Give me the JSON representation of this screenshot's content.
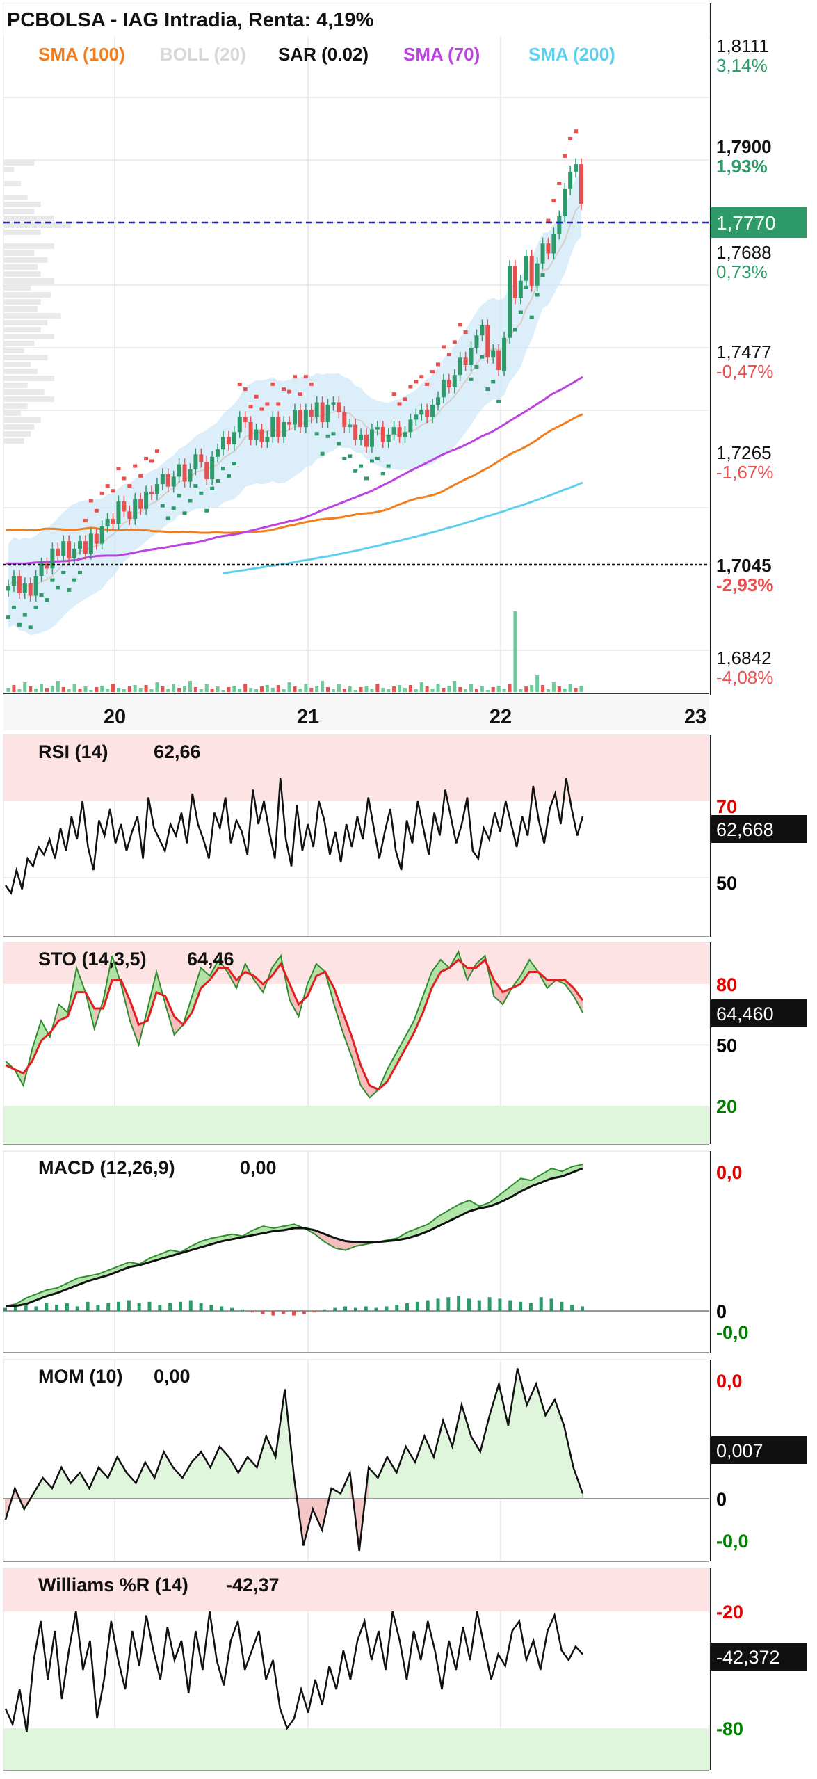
{
  "chart_data": {
    "type": "candlestick",
    "title": "PCBOLSA - IAG Intradia, Renta: 4,19%",
    "indicators_legend": [
      {
        "label": "SMA (100)",
        "color": "#f07d1e"
      },
      {
        "label": "BOLL (20)",
        "color": "#d8d8d8"
      },
      {
        "label": "SAR (0.02)",
        "color": "#111111"
      },
      {
        "label": "SMA (70)",
        "color": "#bb44e0"
      },
      {
        "label": "SMA (200)",
        "color": "#5dd0ee"
      }
    ],
    "x_ticks": [
      "20",
      "21",
      "22",
      "23"
    ],
    "price_levels": [
      {
        "value": "1,8111",
        "pct": "3,14%",
        "bold": false
      },
      {
        "value": "1,7900",
        "pct": "1,93%",
        "bold": true
      },
      {
        "value": "1,7688",
        "pct": "0,73%",
        "bold": false
      },
      {
        "value": "1,7477",
        "pct": "-0,47%",
        "bold": false
      },
      {
        "value": "1,7265",
        "pct": "-1,67%",
        "bold": false
      },
      {
        "value": "1,7045",
        "pct": "-2,93%",
        "bold": true
      },
      {
        "value": "1,6842",
        "pct": "-4,08%",
        "bold": false
      }
    ],
    "current_price": "1,7770",
    "reference_price": 1.7045,
    "y_range": [
      1.6842,
      1.8111
    ],
    "price_series": {
      "close": [
        1.7,
        1.702,
        1.6985,
        1.7005,
        1.698,
        1.702,
        1.7045,
        1.7035,
        1.7075,
        1.706,
        1.709,
        1.7055,
        1.7075,
        1.709,
        1.7065,
        1.7105,
        1.7085,
        1.712,
        1.7135,
        1.7125,
        1.717,
        1.715,
        1.7135,
        1.7175,
        1.7155,
        1.719,
        1.7185,
        1.7205,
        1.7225,
        1.72,
        1.722,
        1.7245,
        1.721,
        1.7235,
        1.7265,
        1.725,
        1.7215,
        1.726,
        1.7275,
        1.73,
        1.7285,
        1.731,
        1.734,
        1.733,
        1.7295,
        1.7315,
        1.729,
        1.73,
        1.734,
        1.73,
        1.733,
        1.7325,
        1.7355,
        1.732,
        1.7355,
        1.734,
        1.737,
        1.733,
        1.7365,
        1.737,
        1.735,
        1.732,
        1.7325,
        1.7295,
        1.7305,
        1.728,
        1.7315,
        1.732,
        1.729,
        1.7305,
        1.732,
        1.73,
        1.731,
        1.7335,
        1.7345,
        1.7355,
        1.734,
        1.7365,
        1.738,
        1.7415,
        1.74,
        1.7425,
        1.746,
        1.7445,
        1.748,
        1.7505,
        1.7525,
        1.746,
        1.7475,
        1.7435,
        1.75,
        1.7645,
        1.758,
        1.7615,
        1.7665,
        1.7605,
        1.765,
        1.769,
        1.767,
        1.771,
        1.7745,
        1.78,
        1.7835,
        1.785,
        1.777
      ],
      "sma100": [
        1.7112,
        1.7113,
        1.7113,
        1.7112,
        1.7112,
        1.7115,
        1.7115,
        1.7114,
        1.7113,
        1.7113,
        1.7115,
        1.7117,
        1.7115,
        1.7113,
        1.7112,
        1.7112,
        1.7113,
        1.7113,
        1.7112,
        1.711,
        1.711,
        1.7108,
        1.7108,
        1.7109,
        1.7108,
        1.7107,
        1.7107,
        1.7108,
        1.7107,
        1.7107,
        1.7108,
        1.7109,
        1.7109,
        1.711,
        1.7112,
        1.7116,
        1.712,
        1.7123,
        1.7127,
        1.713,
        1.7133,
        1.7135,
        1.7136,
        1.7138,
        1.7141,
        1.7144,
        1.7146,
        1.7147,
        1.715,
        1.7154,
        1.7161,
        1.7167,
        1.7173,
        1.7177,
        1.718,
        1.7184,
        1.719,
        1.7199,
        1.7207,
        1.7215,
        1.7222,
        1.7231,
        1.7239,
        1.7249,
        1.7259,
        1.7268,
        1.7275,
        1.7283,
        1.7293,
        1.7304,
        1.7314,
        1.7322,
        1.733,
        1.7339,
        1.7346
      ],
      "sma70": [
        1.7045,
        1.7045,
        1.7045,
        1.7047,
        1.7048,
        1.7049,
        1.705,
        1.7052,
        1.7057,
        1.706,
        1.7061,
        1.7061,
        1.7064,
        1.7068,
        1.7072,
        1.7075,
        1.7078,
        1.7082,
        1.7085,
        1.7088,
        1.7093,
        1.7099,
        1.7102,
        1.7105,
        1.711,
        1.7115,
        1.712,
        1.7125,
        1.713,
        1.7134,
        1.7141,
        1.715,
        1.7158,
        1.7166,
        1.7174,
        1.7182,
        1.719,
        1.72,
        1.721,
        1.7221,
        1.7232,
        1.7242,
        1.7252,
        1.7263,
        1.7272,
        1.728,
        1.729,
        1.7301,
        1.731,
        1.7322,
        1.7335,
        1.7347,
        1.736,
        1.7373,
        1.7387,
        1.7397,
        1.7409,
        1.7421
      ],
      "sma200": [
        1.7025,
        1.7028,
        1.7031,
        1.7034,
        1.7037,
        1.704,
        1.7043,
        1.7046,
        1.705,
        1.7053,
        1.7057,
        1.706,
        1.7064,
        1.7068,
        1.7072,
        1.7077,
        1.7081,
        1.7086,
        1.709,
        1.7095,
        1.71,
        1.7105,
        1.711,
        1.7116,
        1.7121,
        1.7127,
        1.7133,
        1.7139,
        1.7145,
        1.7151,
        1.7158,
        1.7164,
        1.7171,
        1.7178,
        1.7185,
        1.7193,
        1.72,
        1.7208
      ]
    },
    "panels": [
      {
        "name": "RSI (14)",
        "value": "62,66",
        "current": "62,668",
        "levels": [
          {
            "label": "70",
            "color": "#e00000"
          },
          {
            "label": "50",
            "color": "#000000"
          }
        ],
        "zones": [
          "overbought",
          "none"
        ],
        "values": [
          48,
          46,
          52,
          47,
          55,
          53,
          58,
          56,
          60,
          55,
          63,
          57,
          66,
          60,
          70,
          58,
          52,
          65,
          61,
          68,
          59,
          64,
          57,
          62,
          66,
          55,
          71,
          63,
          60,
          57,
          64,
          61,
          67,
          59,
          72,
          64,
          60,
          55,
          67,
          63,
          71,
          59,
          65,
          62,
          56,
          73,
          64,
          70,
          62,
          55,
          76,
          60,
          53,
          69,
          57,
          64,
          58,
          70,
          65,
          56,
          62,
          54,
          64,
          58,
          66,
          60,
          71,
          63,
          55,
          62,
          68,
          57,
          52,
          65,
          59,
          70,
          63,
          56,
          67,
          61,
          73,
          66,
          59,
          64,
          71,
          57,
          55,
          63,
          60,
          67,
          62,
          70,
          64,
          58,
          66,
          61,
          74,
          65,
          59,
          68,
          72,
          64,
          76,
          68,
          61,
          66
        ]
      },
      {
        "name": "STO (14,3,5)",
        "value": "64,46",
        "current": "64,460",
        "levels": [
          {
            "label": "80",
            "color": "#e00000"
          },
          {
            "label": "50",
            "color": "#000000"
          },
          {
            "label": "20",
            "color": "#008000"
          }
        ],
        "zones": [
          "overbought",
          "oversold"
        ],
        "k": [
          42,
          38,
          30,
          48,
          62,
          54,
          70,
          66,
          88,
          76,
          58,
          72,
          94,
          80,
          62,
          50,
          68,
          86,
          70,
          55,
          60,
          74,
          88,
          84,
          92,
          86,
          78,
          90,
          82,
          76,
          88,
          94,
          72,
          64,
          80,
          90,
          86,
          70,
          56,
          44,
          30,
          24,
          28,
          38,
          46,
          54,
          62,
          74,
          86,
          92,
          88,
          96,
          82,
          90,
          94,
          74,
          70,
          78,
          84,
          92,
          86,
          78,
          82,
          80,
          74,
          66
        ],
        "d": [
          40,
          38,
          36,
          42,
          52,
          56,
          62,
          64,
          76,
          76,
          68,
          68,
          82,
          82,
          72,
          60,
          62,
          76,
          74,
          64,
          60,
          66,
          78,
          82,
          88,
          88,
          82,
          86,
          84,
          80,
          84,
          90,
          80,
          70,
          74,
          84,
          86,
          78,
          66,
          54,
          40,
          30,
          28,
          32,
          40,
          48,
          56,
          66,
          78,
          86,
          88,
          92,
          88,
          88,
          92,
          82,
          76,
          78,
          80,
          86,
          86,
          82,
          82,
          82,
          78,
          72
        ]
      },
      {
        "name": "MACD (12,26,9)",
        "value": "0,00",
        "levels": [
          {
            "label": "0,0",
            "color": "#e00000"
          },
          {
            "label": "0",
            "color": "#000000"
          },
          {
            "label": "-0,0",
            "color": "#008000"
          }
        ],
        "macd": [
          -0.2,
          -0.18,
          -0.12,
          -0.08,
          -0.04,
          -0.02,
          0.03,
          0.08,
          0.1,
          0.12,
          0.16,
          0.2,
          0.24,
          0.22,
          0.28,
          0.32,
          0.36,
          0.34,
          0.4,
          0.45,
          0.48,
          0.5,
          0.52,
          0.5,
          0.56,
          0.6,
          0.58,
          0.6,
          0.62,
          0.58,
          0.52,
          0.44,
          0.38,
          0.36,
          0.4,
          0.42,
          0.44,
          0.46,
          0.48,
          0.54,
          0.58,
          0.62,
          0.7,
          0.76,
          0.82,
          0.86,
          0.8,
          0.84,
          0.92,
          1,
          1.08,
          1.06,
          1.12,
          1.18,
          1.15,
          1.2,
          1.22
        ],
        "signal": [
          -0.2,
          -0.2,
          -0.18,
          -0.14,
          -0.1,
          -0.07,
          -0.03,
          0.01,
          0.05,
          0.08,
          0.11,
          0.15,
          0.19,
          0.21,
          0.24,
          0.27,
          0.3,
          0.33,
          0.36,
          0.39,
          0.42,
          0.45,
          0.47,
          0.49,
          0.51,
          0.53,
          0.55,
          0.56,
          0.58,
          0.58,
          0.56,
          0.52,
          0.48,
          0.45,
          0.44,
          0.44,
          0.44,
          0.45,
          0.46,
          0.48,
          0.51,
          0.55,
          0.6,
          0.65,
          0.7,
          0.75,
          0.78,
          0.8,
          0.84,
          0.89,
          0.95,
          1,
          1.04,
          1.08,
          1.1,
          1.14,
          1.18
        ],
        "hist": [
          2,
          3,
          4,
          3,
          5,
          4,
          5,
          3,
          6,
          4,
          5,
          6,
          7,
          5,
          6,
          4,
          5,
          6,
          7,
          5,
          4,
          3,
          2,
          1,
          -1,
          -2,
          -3,
          -2,
          -3,
          -2,
          -1,
          1,
          2,
          3,
          2,
          3,
          2,
          3,
          4,
          5,
          6,
          7,
          8,
          9,
          10,
          8,
          7,
          9,
          8,
          7,
          6,
          5,
          9,
          8,
          6,
          4,
          3
        ],
        "hist_scale": 2.2
      },
      {
        "name": "MOM (10)",
        "value": "0,00",
        "current": "0,007",
        "levels": [
          {
            "label": "0,0",
            "color": "#e00000"
          },
          {
            "label": "0",
            "color": "#000000"
          },
          {
            "label": "-0,0",
            "color": "#008000"
          }
        ],
        "values": [
          -0.2,
          0.1,
          -0.1,
          0.05,
          0.2,
          0.1,
          0.3,
          0.15,
          0.25,
          0.1,
          0.3,
          0.2,
          0.4,
          0.25,
          0.15,
          0.35,
          0.2,
          0.45,
          0.3,
          0.2,
          0.35,
          0.45,
          0.3,
          0.5,
          0.4,
          0.25,
          0.4,
          0.3,
          0.6,
          0.4,
          1.05,
          0.2,
          -0.45,
          -0.1,
          -0.3,
          0.1,
          0.05,
          0.25,
          -0.5,
          0.3,
          0.2,
          0.4,
          0.25,
          0.5,
          0.35,
          0.6,
          0.4,
          0.75,
          0.5,
          0.9,
          0.6,
          0.45,
          0.8,
          1.1,
          0.7,
          1.25,
          0.9,
          1.1,
          0.8,
          0.95,
          0.7,
          0.3,
          0.05
        ]
      },
      {
        "name": "Williams %R (14)",
        "value": "-42,37",
        "current": "-42,372",
        "levels": [
          {
            "label": "-20",
            "color": "#e00000"
          },
          {
            "label": "-80",
            "color": "#008000"
          }
        ],
        "zones": [
          "overbought",
          "oversold"
        ],
        "values": [
          -70,
          -78,
          -60,
          -82,
          -45,
          -25,
          -55,
          -30,
          -65,
          -40,
          -20,
          -50,
          -35,
          -75,
          -55,
          -25,
          -45,
          -60,
          -30,
          -48,
          -22,
          -40,
          -55,
          -28,
          -45,
          -35,
          -62,
          -30,
          -50,
          -20,
          -45,
          -58,
          -35,
          -25,
          -50,
          -40,
          -30,
          -55,
          -45,
          -70,
          -80,
          -75,
          -60,
          -72,
          -55,
          -68,
          -48,
          -60,
          -40,
          -55,
          -35,
          -25,
          -45,
          -30,
          -50,
          -20,
          -35,
          -55,
          -30,
          -45,
          -25,
          -40,
          -60,
          -35,
          -50,
          -28,
          -45,
          -20,
          -38,
          -55,
          -42,
          -48,
          -30,
          -25,
          -45,
          -35,
          -50,
          -30,
          -22,
          -40,
          -45,
          -38,
          -42
        ]
      }
    ]
  }
}
